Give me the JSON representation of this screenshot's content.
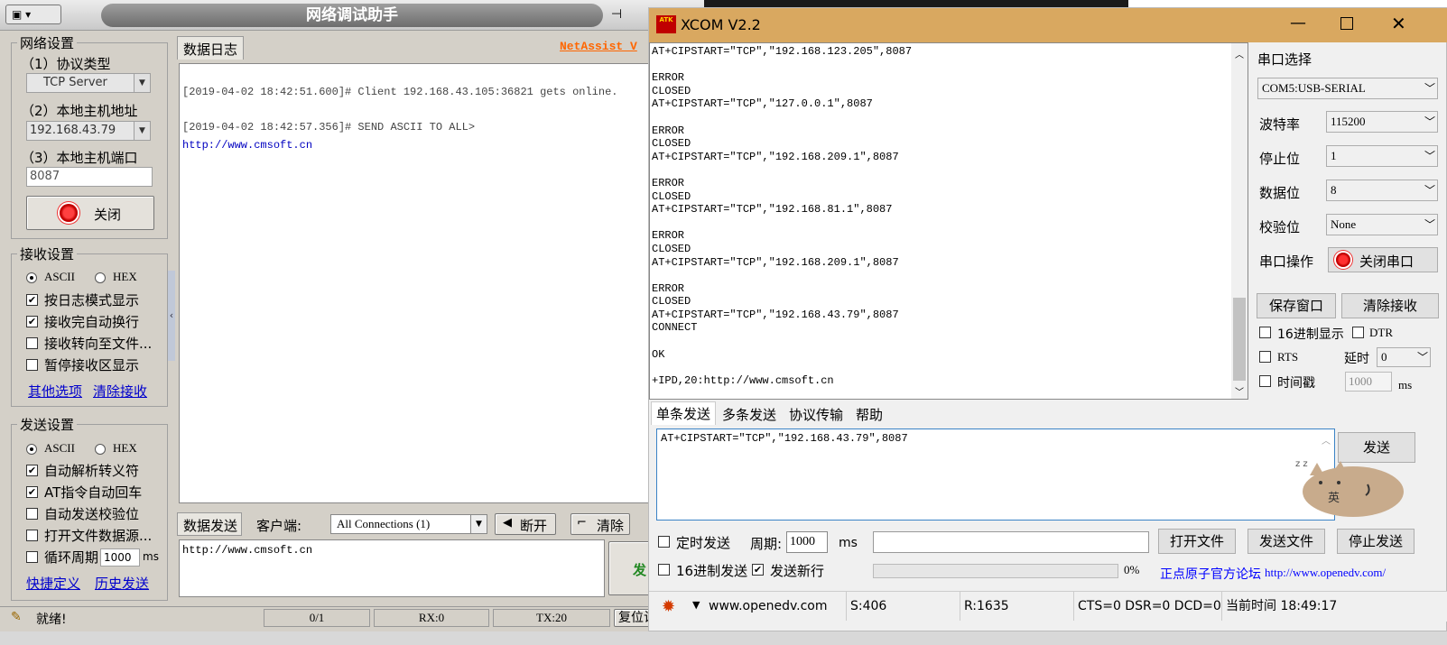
{
  "netassist": {
    "title": "网络调试助手",
    "brand": "NetAssist V",
    "net": {
      "group": "网络设置",
      "protocol_label": "（1）协议类型",
      "protocol": "TCP Server",
      "host_label": "（2）本地主机地址",
      "host": "192.168.43.79",
      "port_label": "（3）本地主机端口",
      "port": "8087",
      "close_btn": "关闭"
    },
    "recv": {
      "group": "接收设置",
      "ascii": "ASCII",
      "hex": "HEX",
      "opt1": "按日志模式显示",
      "opt2": "接收完自动换行",
      "opt3": "接收转向至文件...",
      "opt4": "暂停接收区显示",
      "link1": "其他选项",
      "link2": "清除接收"
    },
    "send": {
      "group": "发送设置",
      "ascii": "ASCII",
      "hex": "HEX",
      "opt1": "自动解析转义符",
      "opt2": "AT指令自动回车",
      "opt3": "自动发送校验位",
      "opt4": "打开文件数据源...",
      "opt5": "循环周期",
      "period": "1000",
      "unit": "ms",
      "link1": "快捷定义",
      "link2": "历史发送"
    },
    "log": {
      "tab": "数据日志",
      "line1": "[2019-04-02 18:42:51.600]# Client 192.168.43.105:36821 gets online.",
      "line2": "[2019-04-02 18:42:57.356]# SEND ASCII TO ALL>",
      "line3": "http://www.cmsoft.cn"
    },
    "sendbar": {
      "tab": "数据发送",
      "client_label": "客户端:",
      "client": "All Connections (1)",
      "disconnect": "断开",
      "clear": "清除",
      "text": "http://www.cmsoft.cn",
      "send_btn": "发"
    },
    "status": {
      "ready": "就绪!",
      "count": "0/1",
      "rx": "RX:0",
      "tx": "TX:20",
      "reset": "复位计数"
    }
  },
  "xcom": {
    "title": "XCOM V2.2",
    "recv_lines": [
      "AT+CIPSTART=\"TCP\",\"192.168.123.205\",8087",
      "",
      "ERROR",
      "CLOSED",
      "AT+CIPSTART=\"TCP\",\"127.0.0.1\",8087",
      "",
      "ERROR",
      "CLOSED",
      "AT+CIPSTART=\"TCP\",\"192.168.209.1\",8087",
      "",
      "ERROR",
      "CLOSED",
      "AT+CIPSTART=\"TCP\",\"192.168.81.1\",8087",
      "",
      "ERROR",
      "CLOSED",
      "AT+CIPSTART=\"TCP\",\"192.168.209.1\",8087",
      "",
      "ERROR",
      "CLOSED",
      "AT+CIPSTART=\"TCP\",\"192.168.43.79\",8087",
      "CONNECT",
      "",
      "OK",
      "",
      "+IPD,20:http://www.cmsoft.cn"
    ],
    "port_label": "串口选择",
    "port": "COM5:USB-SERIAL",
    "baud_label": "波特率",
    "baud": "115200",
    "stop_label": "停止位",
    "stop": "1",
    "data_label": "数据位",
    "data": "8",
    "parity_label": "校验位",
    "parity": "None",
    "op_label": "串口操作",
    "op_btn": "关闭串口",
    "save_btn": "保存窗口",
    "clear_btn": "清除接收",
    "hex_show": "16进制显示",
    "dtr": "DTR",
    "rts": "RTS",
    "delay_label": "延时",
    "delay": "0",
    "timestamp": "时间戳",
    "ts_value": "1000",
    "ts_unit": "ms",
    "tabs": [
      "单条发送",
      "多条发送",
      "协议传输",
      "帮助"
    ],
    "send_text": "AT+CIPSTART=\"TCP\",\"192.168.43.79\",8087",
    "send_btn": "发送",
    "pet_text": "英",
    "timed_send": "定时发送",
    "period_label": "周期:",
    "period": "1000",
    "period_unit": "ms",
    "open_file": "打开文件",
    "send_file": "发送文件",
    "stop_send": "停止发送",
    "hex_send": "16进制发送",
    "newline": "发送新行",
    "progress": "0%",
    "forum": "正点原子官方论坛",
    "forum_url": "http://www.openedv.com/",
    "status": {
      "site": "www.openedv.com",
      "s": "S:406",
      "r": "R:1635",
      "lines": "CTS=0 DSR=0 DCD=0",
      "time": "当前时间 18:49:17"
    }
  }
}
